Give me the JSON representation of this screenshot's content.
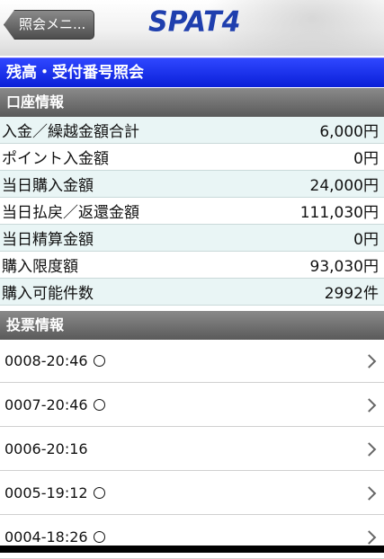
{
  "header": {
    "back_label": "照会メニ...",
    "logo": "SPAT4"
  },
  "page_title": "残高・受付番号照会",
  "account_section": {
    "title": "口座情報",
    "rows": [
      {
        "label": "入金／繰越金額合計",
        "value": "6,000円"
      },
      {
        "label": "ポイント入金額",
        "value": "0円"
      },
      {
        "label": "当日購入金額",
        "value": "24,000円"
      },
      {
        "label": "当日払戻／返還金額",
        "value": "111,030円"
      },
      {
        "label": "当日精算金額",
        "value": "0円"
      },
      {
        "label": "購入限度額",
        "value": "93,030円"
      },
      {
        "label": "購入可能件数",
        "value": "2992件"
      }
    ]
  },
  "vote_section": {
    "title": "投票情報",
    "items": [
      {
        "label": "0008-20:46",
        "marked": true
      },
      {
        "label": "0007-20:46",
        "marked": true
      },
      {
        "label": "0006-20:16",
        "marked": false
      },
      {
        "label": "0005-19:12",
        "marked": true
      },
      {
        "label": "0004-18:26",
        "marked": true
      }
    ]
  }
}
